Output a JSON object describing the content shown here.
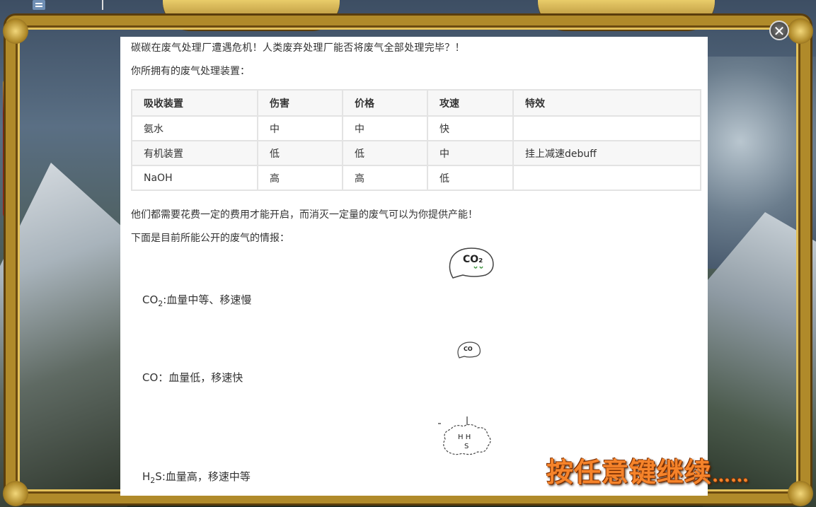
{
  "window": {
    "close_icon": "close-icon"
  },
  "intro_text": "碳碳在废气处理厂遭遇危机！人类废弃处理厂能否将废气全部处理完毕？！",
  "devices_heading": "你所拥有的废气处理装置：",
  "devices_table": {
    "headers": [
      "吸收装置",
      "伤害",
      "价格",
      "攻速",
      "特效"
    ],
    "rows": [
      [
        "氨水",
        "中",
        "中",
        "快",
        ""
      ],
      [
        "有机装置",
        "低",
        "低",
        "中",
        "挂上减速debuff"
      ],
      [
        "NaOH",
        "高",
        "高",
        "低",
        ""
      ]
    ]
  },
  "cost_text": "他们都需要花费一定的费用才能开启，而消灭一定量的废气可以为你提供产能！",
  "intel_heading": "下面是目前所能公开的废气的情报：",
  "gases": {
    "co2": {
      "formula_main": "CO",
      "formula_sub": "2",
      "description": ":血量中等、移速慢",
      "ghost_label": "CO₂"
    },
    "co": {
      "formula_main": "CO",
      "description": "：血量低，移速快",
      "ghost_label": "CO"
    },
    "h2s": {
      "formula_pre": "H",
      "formula_sub": "2",
      "formula_post": "S",
      "description": ":血量高，移速中等",
      "ghost_label_top": "H H",
      "ghost_label_bottom": "S"
    }
  },
  "continue_prompt": {
    "text": "按任意键继续",
    "dots": "……"
  }
}
